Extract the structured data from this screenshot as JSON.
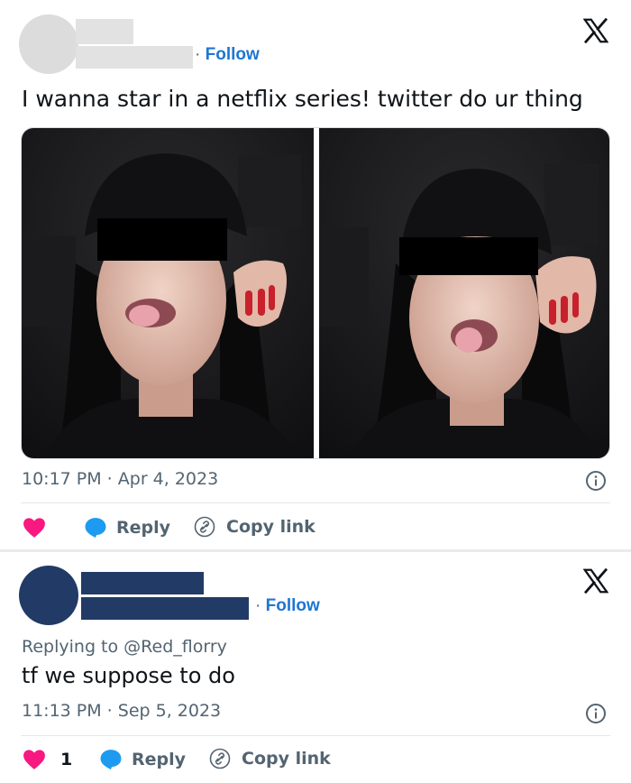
{
  "tweet1": {
    "follow_label": "Follow",
    "follow_separator": "·",
    "text": "I wanna star in a netflix series! twitter do ur thing",
    "timestamp": "10:17 PM · Apr 4, 2023",
    "actions": {
      "reply_label": "Reply",
      "copy_label": "Copy link"
    },
    "media": [
      "photo-left",
      "photo-right"
    ]
  },
  "tweet2": {
    "follow_label": "Follow",
    "follow_separator": "·",
    "replying_to": "Replying to @Red_florry",
    "text": "tf we suppose to do",
    "timestamp": "11:13 PM · Sep 5, 2023",
    "actions": {
      "like_count": "1",
      "reply_label": "Reply",
      "copy_label": "Copy link"
    }
  },
  "colors": {
    "follow_blue": "#1d76d2",
    "like_pink": "#f91880",
    "reply_blue": "#1d9bf0",
    "muted_text": "#536471",
    "avatar1": "#dcdcdc",
    "avatar2": "#223a66"
  },
  "icons": [
    "x-logo-icon",
    "info-icon",
    "heart-icon",
    "reply-bubble-icon",
    "link-icon"
  ]
}
